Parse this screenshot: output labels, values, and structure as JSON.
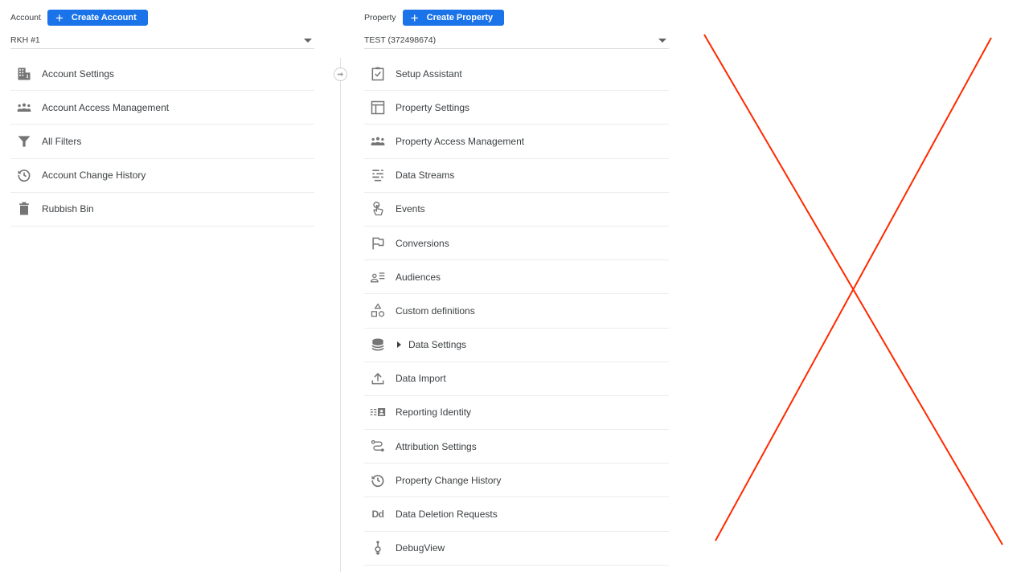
{
  "account": {
    "label": "Account",
    "create_button": "Create Account",
    "selected": "RKH #1",
    "items": [
      {
        "label": "Account Settings",
        "icon": "building-icon"
      },
      {
        "label": "Account Access Management",
        "icon": "people-icon"
      },
      {
        "label": "All Filters",
        "icon": "filter-icon"
      },
      {
        "label": "Account Change History",
        "icon": "history-icon"
      },
      {
        "label": "Rubbish Bin",
        "icon": "trash-icon"
      }
    ]
  },
  "property": {
    "label": "Property",
    "create_button": "Create Property",
    "selected": "TEST (372498674)",
    "items": [
      {
        "label": "Setup Assistant",
        "icon": "clipboard-check-icon"
      },
      {
        "label": "Property Settings",
        "icon": "layout-icon"
      },
      {
        "label": "Property Access Management",
        "icon": "people-icon"
      },
      {
        "label": "Data Streams",
        "icon": "data-streams-icon"
      },
      {
        "label": "Events",
        "icon": "touch-icon"
      },
      {
        "label": "Conversions",
        "icon": "flag-icon"
      },
      {
        "label": "Audiences",
        "icon": "audience-list-icon"
      },
      {
        "label": "Custom definitions",
        "icon": "shapes-icon"
      },
      {
        "label": "Data Settings",
        "icon": "database-icon"
      },
      {
        "label": "Data Import",
        "icon": "upload-icon"
      },
      {
        "label": "Reporting Identity",
        "icon": "reporting-identity-icon"
      },
      {
        "label": "Attribution Settings",
        "icon": "route-icon"
      },
      {
        "label": "Property Change History",
        "icon": "history-icon"
      },
      {
        "label": "Data Deletion Requests",
        "icon": "data-deletion-icon",
        "glyph": "Dd"
      },
      {
        "label": "DebugView",
        "icon": "debug-icon"
      }
    ]
  },
  "overlay": {
    "color": "#ff2a00"
  },
  "colors": {
    "accent": "#1a73e8"
  }
}
